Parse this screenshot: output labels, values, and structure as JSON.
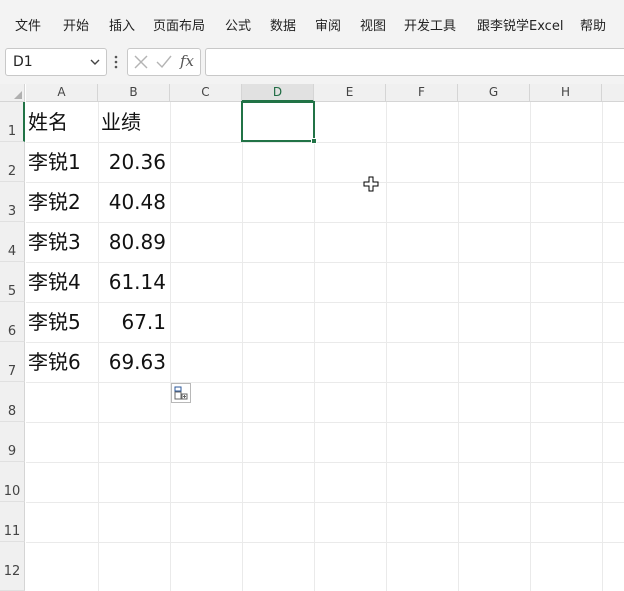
{
  "ribbon": {
    "tabs": [
      "文件",
      "开始",
      "插入",
      "页面布局",
      "公式",
      "数据",
      "审阅",
      "视图",
      "开发工具",
      "跟李锐学Excel",
      "帮助"
    ]
  },
  "formula_bar": {
    "name_box": "D1",
    "fx_label": "fx",
    "formula_value": ""
  },
  "columns": [
    "A",
    "B",
    "C",
    "D",
    "E",
    "F",
    "G",
    "H"
  ],
  "active_column": "D",
  "rows": [
    "1",
    "2",
    "3",
    "4",
    "5",
    "6",
    "7",
    "8",
    "9",
    "10",
    "11",
    "12"
  ],
  "active_row": "1",
  "sheet": {
    "header": {
      "a": "姓名",
      "b": "业绩"
    },
    "data": [
      {
        "a": "李锐1",
        "b": "20.36"
      },
      {
        "a": "李锐2",
        "b": "40.48"
      },
      {
        "a": "李锐3",
        "b": "80.89"
      },
      {
        "a": "李锐4",
        "b": "61.14"
      },
      {
        "a": "李锐5",
        "b": "67.1"
      },
      {
        "a": "李锐6",
        "b": "69.63"
      }
    ]
  },
  "colors": {
    "selection": "#217346",
    "ribbon_bg": "#f3f3f3",
    "header_bg": "#f0f0f0"
  },
  "icons": {
    "name_box_dropdown": "chevron-down-icon",
    "cancel": "cancel-x-icon",
    "confirm": "check-icon",
    "paste_options": "paste-options-icon",
    "cursor": "cell-cross-cursor-icon"
  }
}
